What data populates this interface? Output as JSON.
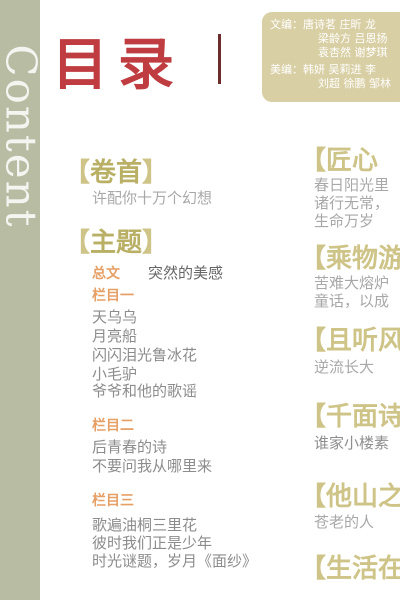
{
  "side_title": "Content",
  "page_title": "目录",
  "credits": {
    "editors_label": "文编：",
    "editors_line1": "唐诗茗 庄昕 龙",
    "editors_line2": "梁龄方 吕恩扬",
    "editors_line3": "袁杏然 谢梦琪",
    "art_label": "美编：",
    "art_line1": "韩妍 吴莉进 李",
    "art_line2": "刘超 徐鹏 邹林"
  },
  "left": {
    "juanshou": {
      "head_open": "【",
      "head_text": "卷首",
      "head_close": "】",
      "desc": "许配你十万个幻想"
    },
    "zhuti": {
      "head_open": "【",
      "head_text": "主题",
      "head_close": "】",
      "zongwen_label": "总文",
      "zongwen_text": "突然的美感",
      "lanmu1_label": "栏目一",
      "lanmu1_items": [
        "天乌乌",
        "月亮船",
        "闪闪泪光鲁冰花",
        "小毛驴",
        "爷爷和他的歌谣"
      ],
      "lanmu2_label": "栏目二",
      "lanmu2_items": [
        "后青春的诗",
        "不要问我从哪里来"
      ],
      "lanmu3_label": "栏目三",
      "lanmu3_items": [
        "歌遍油桐三里花",
        "彼时我们正是少年",
        "时光谜题，岁月《面纱》"
      ]
    }
  },
  "right": {
    "jiangxin": {
      "head": "【匠心",
      "lines": [
        "春日阳光里",
        "诸行无常，",
        "生命万岁"
      ]
    },
    "chengwu": {
      "head": "【乘物游",
      "lines": [
        "苦难大熔炉",
        "童话，以成"
      ]
    },
    "qieting": {
      "head": "【且听风",
      "lines": [
        "逆流长大"
      ]
    },
    "qianmian": {
      "head": "【千面诗",
      "lines": [
        "谁家小楼素"
      ]
    },
    "tashan": {
      "head": "【他山之",
      "lines": [
        "苍老的人"
      ]
    },
    "shenghuo": {
      "head": "【生活在"
    }
  }
}
